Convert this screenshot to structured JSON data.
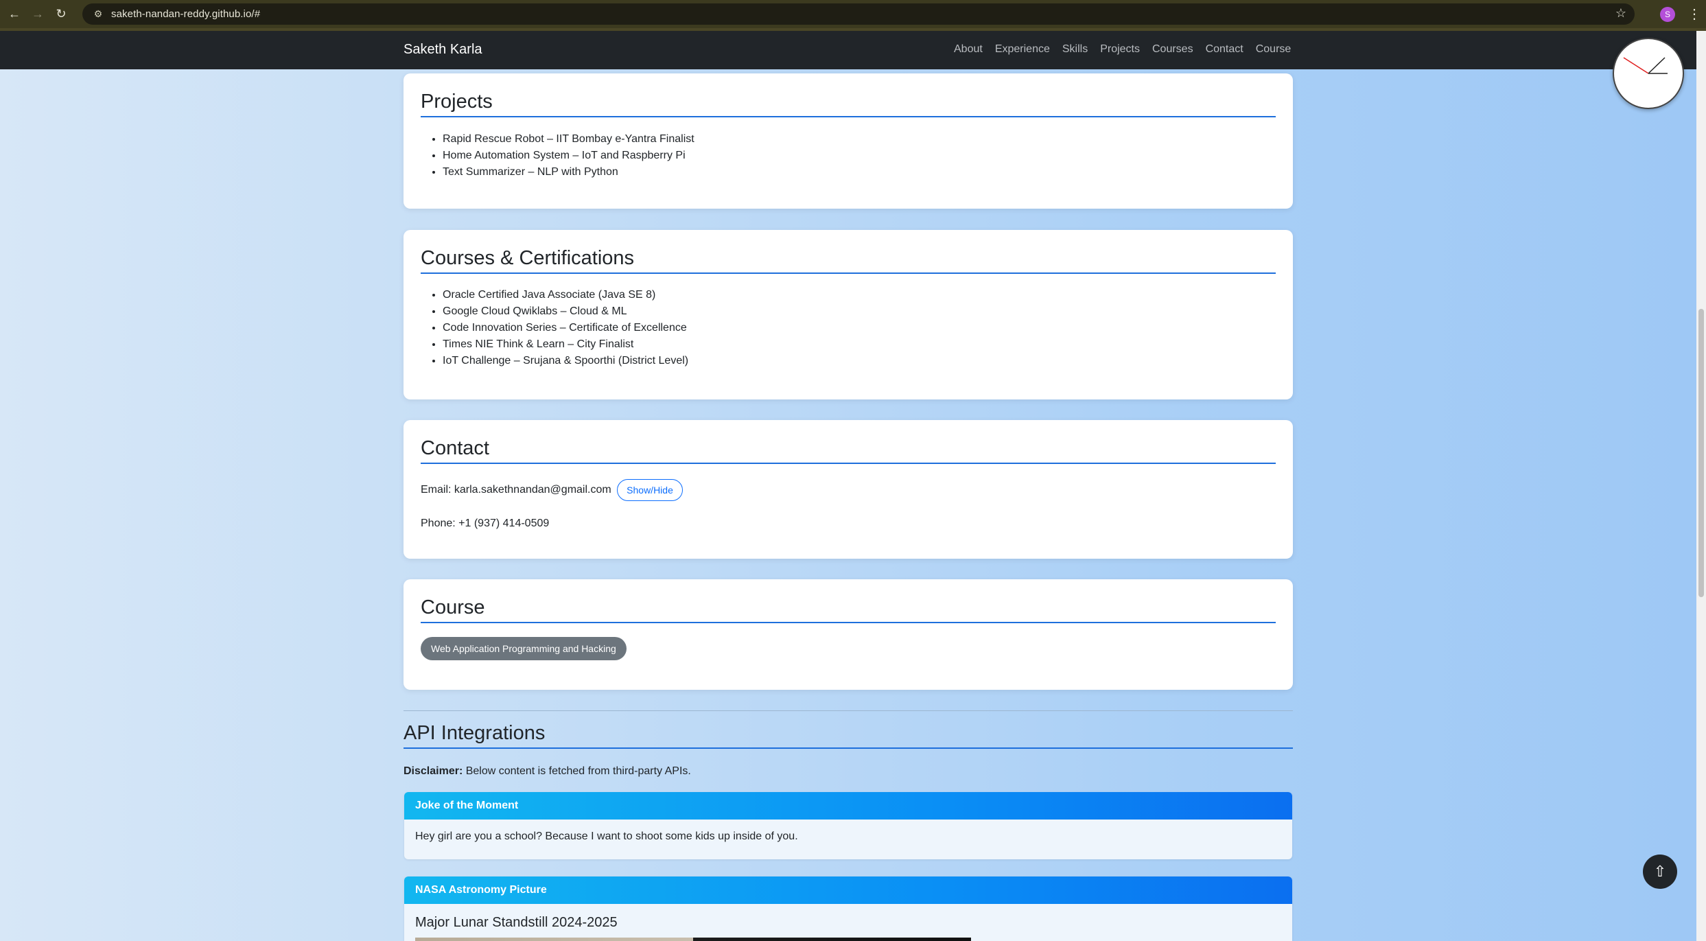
{
  "browser": {
    "url": "saketh-nandan-reddy.github.io/#",
    "profile_initial": "S"
  },
  "site": {
    "brand": "Saketh Karla",
    "nav": [
      "About",
      "Experience",
      "Skills",
      "Projects",
      "Courses",
      "Contact",
      "Course"
    ]
  },
  "projects": {
    "title": "Projects",
    "items": [
      "Rapid Rescue Robot – IIT Bombay e-Yantra Finalist",
      "Home Automation System – IoT and Raspberry Pi",
      "Text Summarizer – NLP with Python"
    ]
  },
  "courses": {
    "title": "Courses & Certifications",
    "items": [
      "Oracle Certified Java Associate (Java SE 8)",
      "Google Cloud Qwiklabs – Cloud & ML",
      "Code Innovation Series – Certificate of Excellence",
      "Times NIE Think & Learn – City Finalist",
      "IoT Challenge – Srujana & Spoorthi (District Level)"
    ]
  },
  "contact": {
    "title": "Contact",
    "email_label": "Email: karla.sakethnandan@gmail.com",
    "toggle_label": "Show/Hide",
    "phone": "Phone: +1 (937) 414-0509"
  },
  "course": {
    "title": "Course",
    "button": "Web Application Programming and Hacking"
  },
  "api": {
    "title": "API Integrations",
    "disclaimer_bold": "Disclaimer:",
    "disclaimer_text": " Below content is fetched from third-party APIs.",
    "joke_title": "Joke of the Moment",
    "joke_text": "Hey girl are you a school? Because I want to shoot some kids up inside of you.",
    "nasa_title": "NASA Astronomy Picture",
    "nasa_heading": "Major Lunar Standstill 2024-2025"
  },
  "back_to_top": "⇧"
}
